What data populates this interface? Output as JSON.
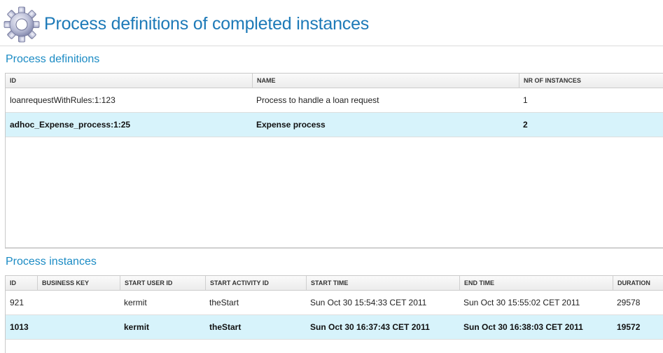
{
  "header": {
    "title": "Process definitions of completed instances",
    "icon": "gear-icon"
  },
  "definitions": {
    "title": "Process definitions",
    "columns": [
      "ID",
      "NAME",
      "NR OF INSTANCES"
    ],
    "rows": [
      {
        "id": "loanrequestWithRules:1:123",
        "name": "Process to handle a loan request",
        "count": "1",
        "selected": false
      },
      {
        "id": "adhoc_Expense_process:1:25",
        "name": "Expense process",
        "count": "2",
        "selected": true
      }
    ]
  },
  "instances": {
    "title": "Process instances",
    "columns": [
      "ID",
      "BUSINESS KEY",
      "START USER ID",
      "START ACTIVITY ID",
      "START TIME",
      "END TIME",
      "DURATION"
    ],
    "rows": [
      {
        "id": "921",
        "business_key": "",
        "user": "kermit",
        "activity": "theStart",
        "start": "Sun Oct 30 15:54:33 CET 2011",
        "end": "Sun Oct 30 15:55:02 CET 2011",
        "duration": "29578",
        "selected": false
      },
      {
        "id": "1013",
        "business_key": "",
        "user": "kermit",
        "activity": "theStart",
        "start": "Sun Oct 30 16:37:43 CET 2011",
        "end": "Sun Oct 30 16:38:03 CET 2011",
        "duration": "19572",
        "selected": true
      }
    ]
  },
  "colors": {
    "title_blue": "#1d7ab8",
    "section_blue": "#1b8bc4",
    "selected_row": "#d7f3fb"
  }
}
